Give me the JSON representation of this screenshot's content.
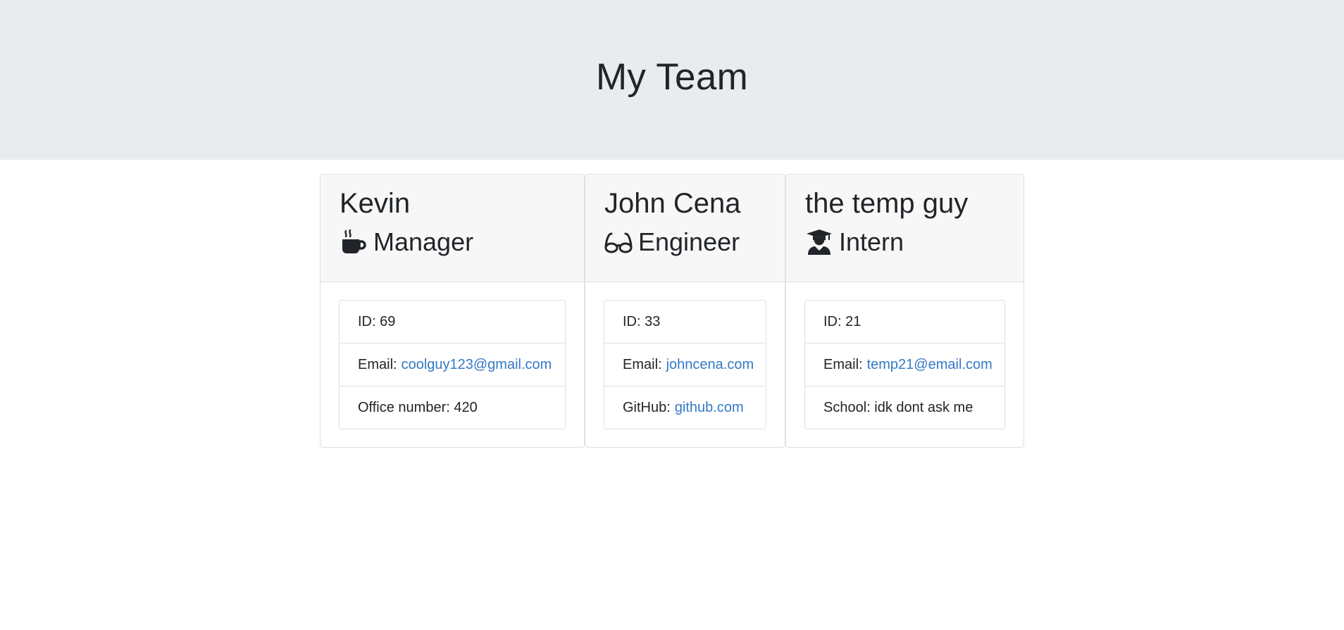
{
  "page_title": "My Team",
  "employees": [
    {
      "name": "Kevin",
      "role": "Manager",
      "role_icon": "coffee-mug-icon",
      "id_text": "ID: 69",
      "email_label": "Email:",
      "email": "coolguy123@gmail.com",
      "extra_text": "Office number: 420"
    },
    {
      "name": "John Cena",
      "role": "Engineer",
      "role_icon": "glasses-icon",
      "id_text": "ID: 33",
      "email_label": "Email:",
      "email": "johncena.com",
      "extra_label": "GitHub:",
      "extra_link": "github.com"
    },
    {
      "name": "the temp guy",
      "role": "Intern",
      "role_icon": "graduate-icon",
      "id_text": "ID: 21",
      "email_label": "Email:",
      "email": "temp21@email.com",
      "extra_text": "School: idk dont ask me"
    }
  ],
  "colors": {
    "header_bg": "#e9ecef",
    "card_header_bg": "#f7f7f7",
    "border": "#dfe1e4",
    "link": "#3479c6",
    "text": "#212529"
  }
}
